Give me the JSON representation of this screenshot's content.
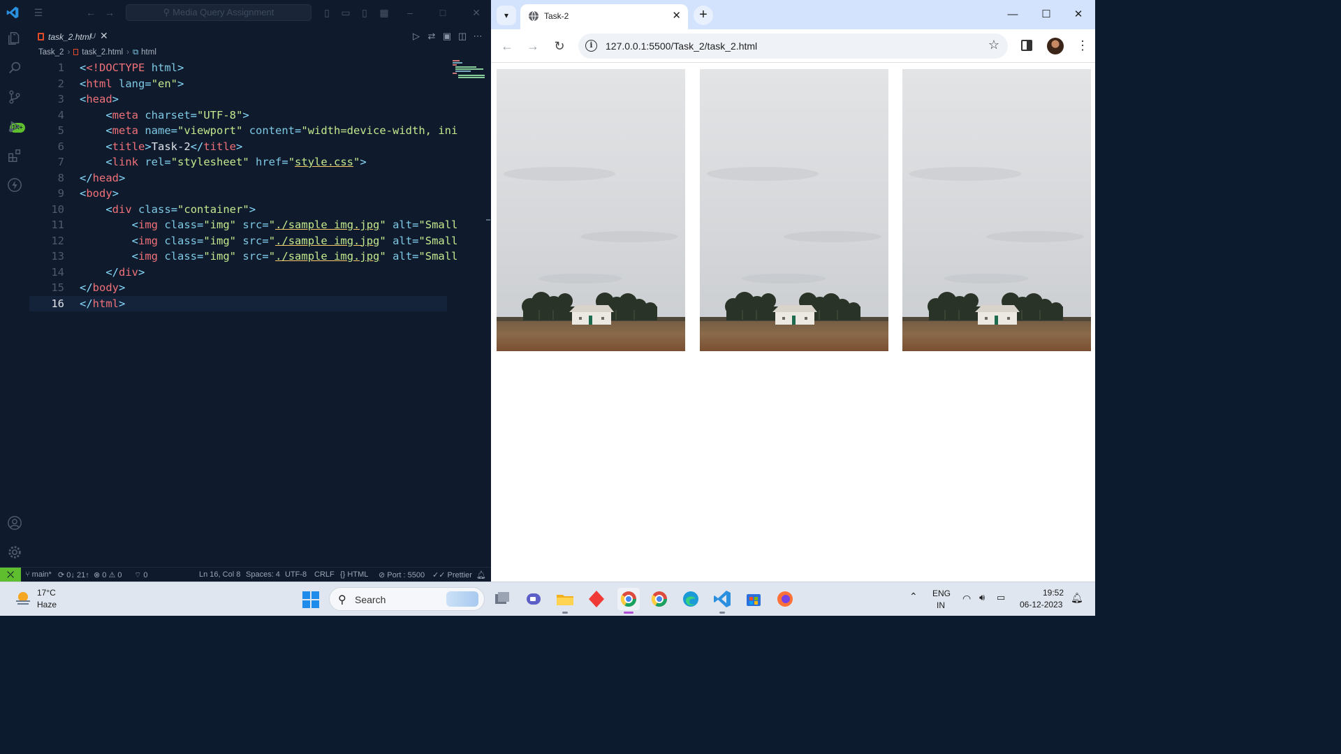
{
  "vscode": {
    "search_placeholder": "Media Query Assignment",
    "tab": {
      "label": "task_2.html",
      "status": "U"
    },
    "breadcrumb": [
      "Task_2",
      "task_2.html",
      "html"
    ],
    "activity_badge": "1K+",
    "lines": [
      {
        "n": "1"
      },
      {
        "n": "2"
      },
      {
        "n": "3"
      },
      {
        "n": "4"
      },
      {
        "n": "5"
      },
      {
        "n": "6"
      },
      {
        "n": "7"
      },
      {
        "n": "8"
      },
      {
        "n": "9"
      },
      {
        "n": "10"
      },
      {
        "n": "11"
      },
      {
        "n": "12"
      },
      {
        "n": "13"
      },
      {
        "n": "14"
      },
      {
        "n": "15"
      },
      {
        "n": "16"
      }
    ],
    "code": {
      "l1_doctype": "<!DOCTYPE",
      "l1_html": "html",
      "l2_tag": "html",
      "lang_attr": "lang",
      "lang_val": "\"en\"",
      "head": "head",
      "meta": "meta",
      "charset_attr": "charset",
      "charset_val": "\"UTF-8\"",
      "name_attr": "name",
      "name_val": "\"viewport\"",
      "content_attr": "content",
      "content_val": "\"width=device-width, ini",
      "title": "title",
      "title_text": "Task-2",
      "link": "link",
      "rel_attr": "rel",
      "rel_val": "\"stylesheet\"",
      "href_attr": "href",
      "href_val": "style.css",
      "body": "body",
      "div": "div",
      "class_attr": "class",
      "container_val": "\"container\"",
      "img": "img",
      "img_class_val": "\"img\"",
      "src_attr": "src",
      "src_val": "./sample img.jpg",
      "alt_attr": "alt",
      "alt_val": "\"Small"
    },
    "status": {
      "branch": "main*",
      "sync": "0↓ 21↑",
      "errors": "0",
      "warnings": "0",
      "ports": "0",
      "position": "Ln 16, Col 8",
      "spaces": "Spaces: 4",
      "encoding": "UTF-8",
      "eol": "CRLF",
      "language": "HTML",
      "port": "Port : 5500",
      "formatter": "Prettier"
    }
  },
  "chrome": {
    "tab_title": "Task-2",
    "url": "127.0.0.1:5500/Task_2/task_2.html",
    "images": [
      {
        "alt": "Small"
      },
      {
        "alt": "Small"
      },
      {
        "alt": "Small"
      }
    ]
  },
  "taskbar": {
    "temperature": "17°C",
    "weather": "Haze",
    "search_label": "Search",
    "lang_top": "ENG",
    "lang_bottom": "IN",
    "time": "19:52",
    "date": "06-12-2023"
  },
  "colors": {
    "vscode_bg": "#0f1b2d",
    "accent_green": "#5fbe2e",
    "chrome_tabstrip": "#d3e3fd",
    "taskbar_bg": "#dfe6ef"
  }
}
